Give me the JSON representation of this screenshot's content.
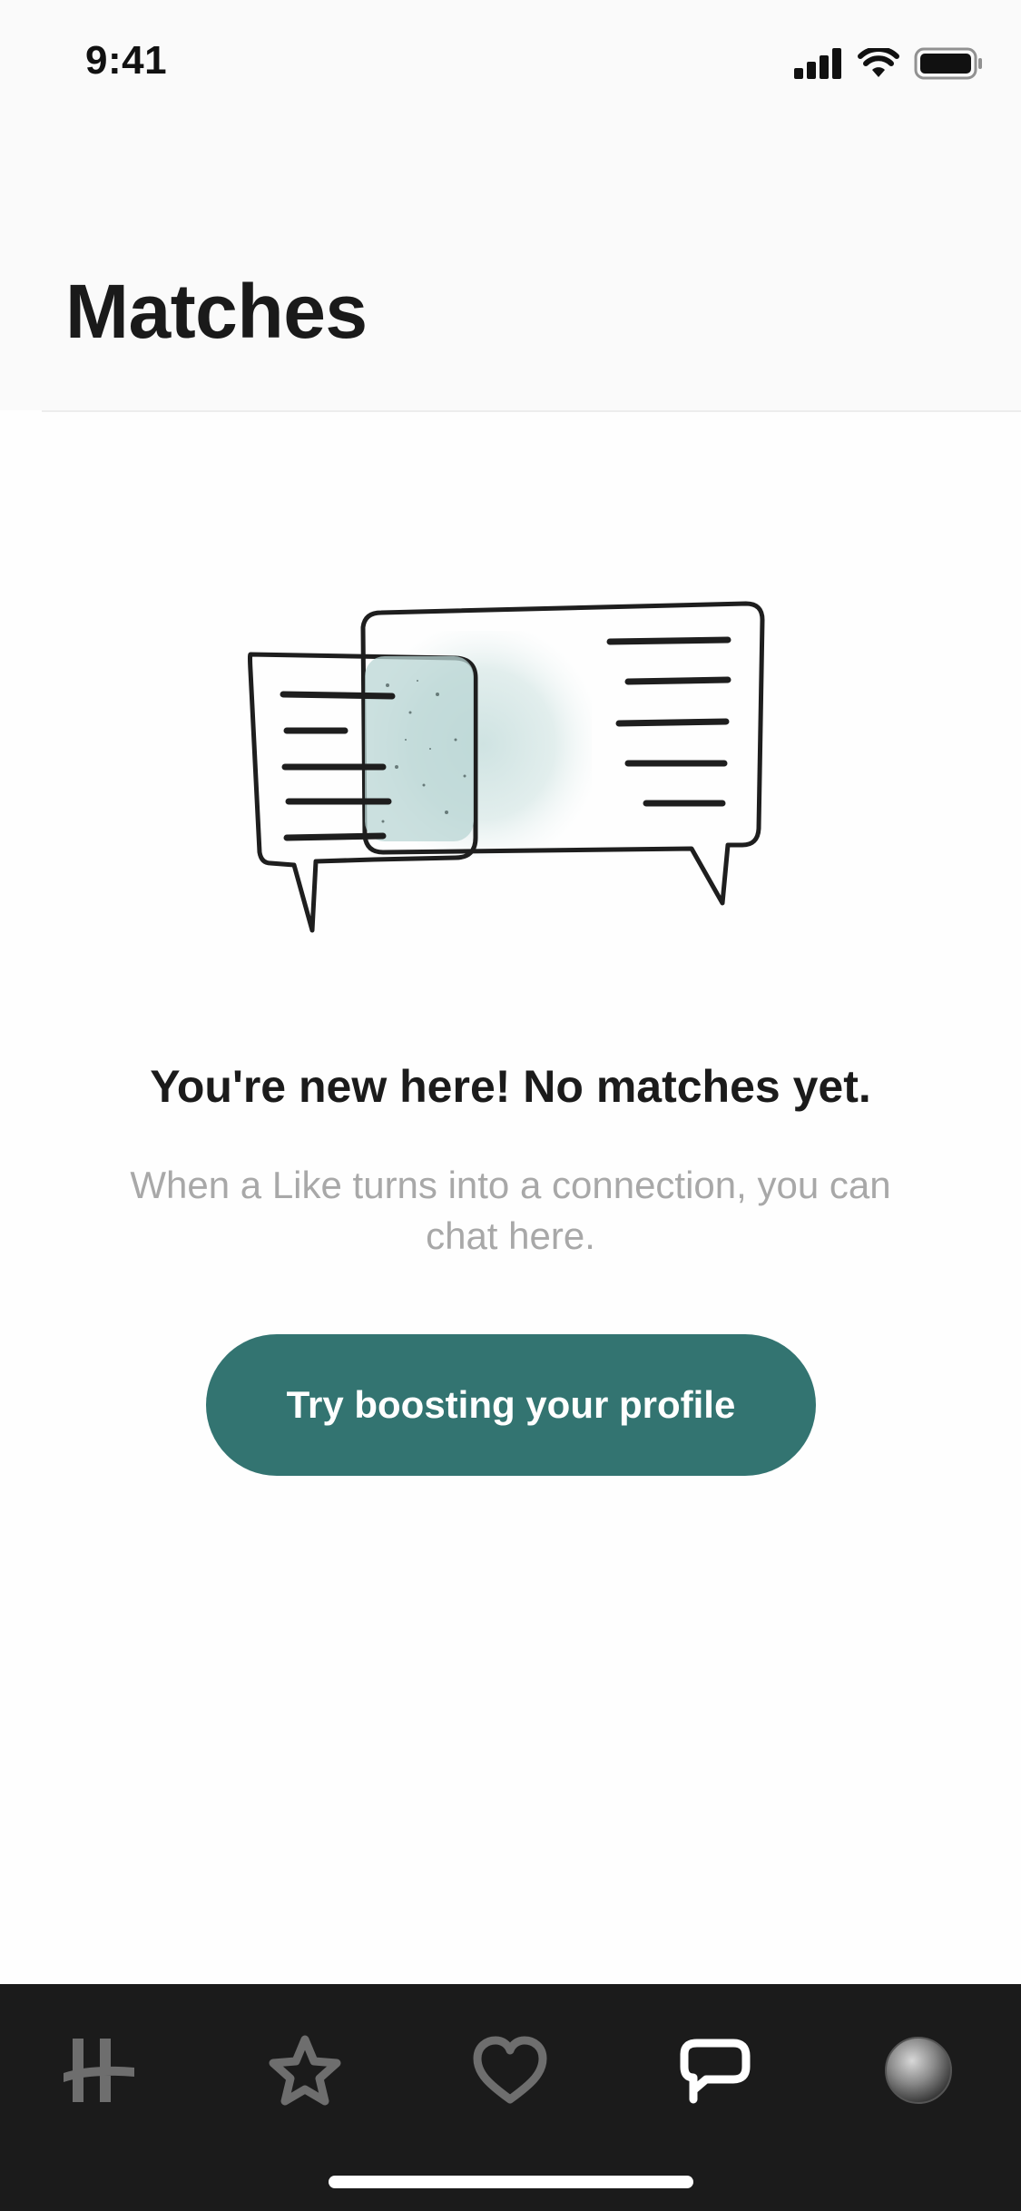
{
  "status_bar": {
    "time": "9:41",
    "icons": [
      "cellular-signal-icon",
      "wifi-icon",
      "battery-icon"
    ]
  },
  "header": {
    "title": "Matches"
  },
  "empty_state": {
    "illustration": "chat-bubbles-illustration",
    "title": "You're new here! No matches yet.",
    "subtitle": "When a Like turns into a connection, you can chat here.",
    "cta_label": "Try boosting your profile"
  },
  "tab_bar": {
    "items": [
      {
        "icon": "hinge-logo-icon",
        "active": false
      },
      {
        "icon": "star-icon",
        "active": false
      },
      {
        "icon": "heart-icon",
        "active": false
      },
      {
        "icon": "chat-icon",
        "active": true
      },
      {
        "icon": "profile-avatar",
        "active": false
      }
    ]
  },
  "colors": {
    "accent": "#337471",
    "tab_bar_bg": "#1b1b1b",
    "tab_inactive": "#6e6e6e",
    "tab_active": "#ffffff",
    "subtitle_text": "#a8a8a8"
  }
}
